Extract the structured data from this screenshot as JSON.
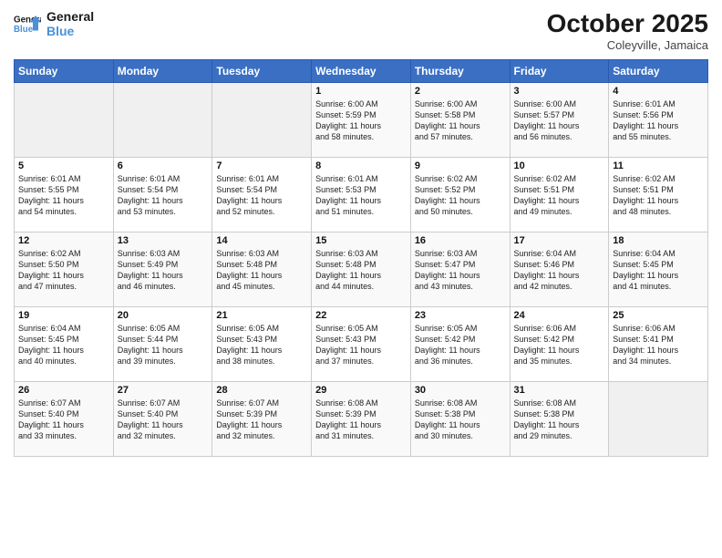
{
  "logo": {
    "line1": "General",
    "line2": "Blue"
  },
  "title": "October 2025",
  "location": "Coleyville, Jamaica",
  "days_of_week": [
    "Sunday",
    "Monday",
    "Tuesday",
    "Wednesday",
    "Thursday",
    "Friday",
    "Saturday"
  ],
  "weeks": [
    [
      {
        "day": "",
        "content": ""
      },
      {
        "day": "",
        "content": ""
      },
      {
        "day": "",
        "content": ""
      },
      {
        "day": "1",
        "content": "Sunrise: 6:00 AM\nSunset: 5:59 PM\nDaylight: 11 hours\nand 58 minutes."
      },
      {
        "day": "2",
        "content": "Sunrise: 6:00 AM\nSunset: 5:58 PM\nDaylight: 11 hours\nand 57 minutes."
      },
      {
        "day": "3",
        "content": "Sunrise: 6:00 AM\nSunset: 5:57 PM\nDaylight: 11 hours\nand 56 minutes."
      },
      {
        "day": "4",
        "content": "Sunrise: 6:01 AM\nSunset: 5:56 PM\nDaylight: 11 hours\nand 55 minutes."
      }
    ],
    [
      {
        "day": "5",
        "content": "Sunrise: 6:01 AM\nSunset: 5:55 PM\nDaylight: 11 hours\nand 54 minutes."
      },
      {
        "day": "6",
        "content": "Sunrise: 6:01 AM\nSunset: 5:54 PM\nDaylight: 11 hours\nand 53 minutes."
      },
      {
        "day": "7",
        "content": "Sunrise: 6:01 AM\nSunset: 5:54 PM\nDaylight: 11 hours\nand 52 minutes."
      },
      {
        "day": "8",
        "content": "Sunrise: 6:01 AM\nSunset: 5:53 PM\nDaylight: 11 hours\nand 51 minutes."
      },
      {
        "day": "9",
        "content": "Sunrise: 6:02 AM\nSunset: 5:52 PM\nDaylight: 11 hours\nand 50 minutes."
      },
      {
        "day": "10",
        "content": "Sunrise: 6:02 AM\nSunset: 5:51 PM\nDaylight: 11 hours\nand 49 minutes."
      },
      {
        "day": "11",
        "content": "Sunrise: 6:02 AM\nSunset: 5:51 PM\nDaylight: 11 hours\nand 48 minutes."
      }
    ],
    [
      {
        "day": "12",
        "content": "Sunrise: 6:02 AM\nSunset: 5:50 PM\nDaylight: 11 hours\nand 47 minutes."
      },
      {
        "day": "13",
        "content": "Sunrise: 6:03 AM\nSunset: 5:49 PM\nDaylight: 11 hours\nand 46 minutes."
      },
      {
        "day": "14",
        "content": "Sunrise: 6:03 AM\nSunset: 5:48 PM\nDaylight: 11 hours\nand 45 minutes."
      },
      {
        "day": "15",
        "content": "Sunrise: 6:03 AM\nSunset: 5:48 PM\nDaylight: 11 hours\nand 44 minutes."
      },
      {
        "day": "16",
        "content": "Sunrise: 6:03 AM\nSunset: 5:47 PM\nDaylight: 11 hours\nand 43 minutes."
      },
      {
        "day": "17",
        "content": "Sunrise: 6:04 AM\nSunset: 5:46 PM\nDaylight: 11 hours\nand 42 minutes."
      },
      {
        "day": "18",
        "content": "Sunrise: 6:04 AM\nSunset: 5:45 PM\nDaylight: 11 hours\nand 41 minutes."
      }
    ],
    [
      {
        "day": "19",
        "content": "Sunrise: 6:04 AM\nSunset: 5:45 PM\nDaylight: 11 hours\nand 40 minutes."
      },
      {
        "day": "20",
        "content": "Sunrise: 6:05 AM\nSunset: 5:44 PM\nDaylight: 11 hours\nand 39 minutes."
      },
      {
        "day": "21",
        "content": "Sunrise: 6:05 AM\nSunset: 5:43 PM\nDaylight: 11 hours\nand 38 minutes."
      },
      {
        "day": "22",
        "content": "Sunrise: 6:05 AM\nSunset: 5:43 PM\nDaylight: 11 hours\nand 37 minutes."
      },
      {
        "day": "23",
        "content": "Sunrise: 6:05 AM\nSunset: 5:42 PM\nDaylight: 11 hours\nand 36 minutes."
      },
      {
        "day": "24",
        "content": "Sunrise: 6:06 AM\nSunset: 5:42 PM\nDaylight: 11 hours\nand 35 minutes."
      },
      {
        "day": "25",
        "content": "Sunrise: 6:06 AM\nSunset: 5:41 PM\nDaylight: 11 hours\nand 34 minutes."
      }
    ],
    [
      {
        "day": "26",
        "content": "Sunrise: 6:07 AM\nSunset: 5:40 PM\nDaylight: 11 hours\nand 33 minutes."
      },
      {
        "day": "27",
        "content": "Sunrise: 6:07 AM\nSunset: 5:40 PM\nDaylight: 11 hours\nand 32 minutes."
      },
      {
        "day": "28",
        "content": "Sunrise: 6:07 AM\nSunset: 5:39 PM\nDaylight: 11 hours\nand 32 minutes."
      },
      {
        "day": "29",
        "content": "Sunrise: 6:08 AM\nSunset: 5:39 PM\nDaylight: 11 hours\nand 31 minutes."
      },
      {
        "day": "30",
        "content": "Sunrise: 6:08 AM\nSunset: 5:38 PM\nDaylight: 11 hours\nand 30 minutes."
      },
      {
        "day": "31",
        "content": "Sunrise: 6:08 AM\nSunset: 5:38 PM\nDaylight: 11 hours\nand 29 minutes."
      },
      {
        "day": "",
        "content": ""
      }
    ]
  ]
}
